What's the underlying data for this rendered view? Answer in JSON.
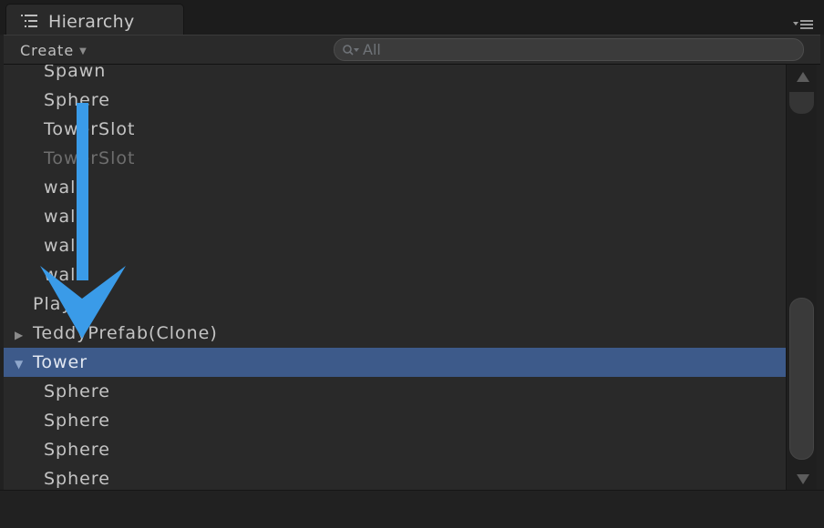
{
  "window": {
    "tab_title": "Hierarchy",
    "tab_icon": "hierarchy-list-icon",
    "panel_menu_icon": "panel-menu-icon"
  },
  "toolbar": {
    "create_label": "Create",
    "search_placeholder": "All"
  },
  "rows": [
    {
      "label": "Spawn",
      "depth": 1,
      "state": "normal"
    },
    {
      "label": "Sphere",
      "depth": 1,
      "state": "normal"
    },
    {
      "label": "TowerSlot",
      "depth": 1,
      "state": "normal"
    },
    {
      "label": "TowerSlot",
      "depth": 1,
      "state": "inactive"
    },
    {
      "label": "wall",
      "depth": 1,
      "state": "normal"
    },
    {
      "label": "wall",
      "depth": 1,
      "state": "normal"
    },
    {
      "label": "wall",
      "depth": 1,
      "state": "normal"
    },
    {
      "label": "wall",
      "depth": 1,
      "state": "normal"
    },
    {
      "label": "Player",
      "depth": 0,
      "state": "normal"
    },
    {
      "label": "TeddyPrefab(Clone)",
      "depth": 0,
      "state": "normal",
      "foldout": "collapsed"
    },
    {
      "label": "Tower",
      "depth": 0,
      "state": "selected",
      "foldout": "expanded"
    },
    {
      "label": "Sphere",
      "depth": 1,
      "state": "normal"
    },
    {
      "label": "Sphere",
      "depth": 1,
      "state": "normal"
    },
    {
      "label": "Sphere",
      "depth": 1,
      "state": "normal"
    },
    {
      "label": "Sphere",
      "depth": 1,
      "state": "normal"
    }
  ],
  "colors": {
    "background": "#292929",
    "selection": "#3d5a8a",
    "annotation_arrow": "#3a9be8"
  }
}
